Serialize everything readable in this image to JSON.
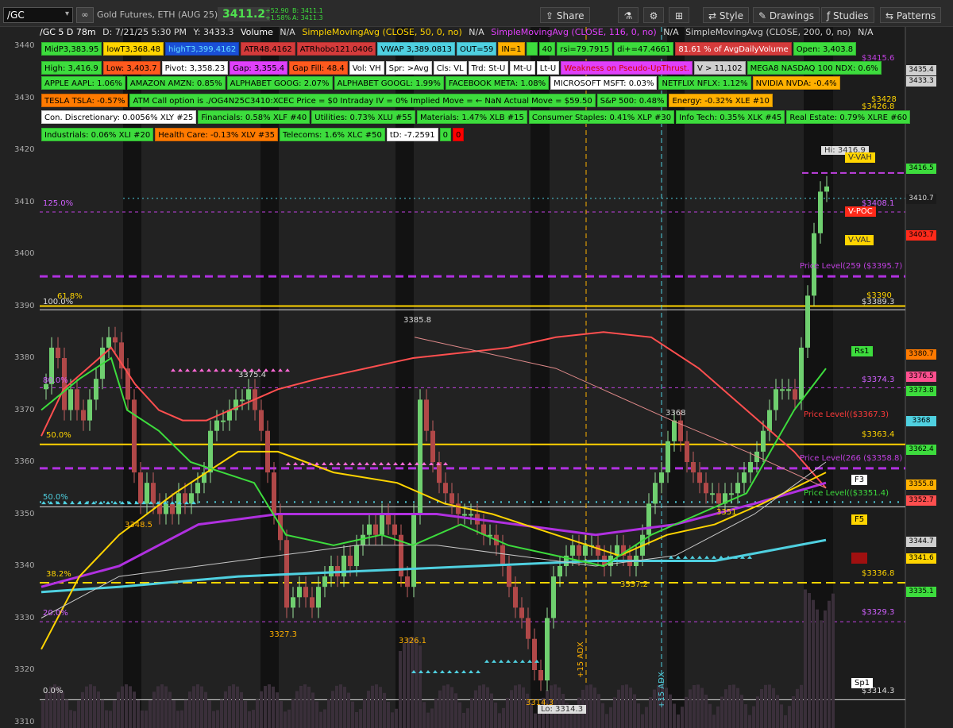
{
  "topbar": {
    "symbol": "/GC",
    "description": "Gold Futures, ETH (AUG 25)",
    "last_price": "3411.2",
    "change_abs": "+52.90",
    "change_pct": "+1.58%",
    "bid": "B: 3411.1",
    "ask": "A: 3411.3",
    "buttons": {
      "share": "Share",
      "style": "Style",
      "drawings": "Drawings",
      "studies": "Studies",
      "patterns": "Patterns"
    }
  },
  "study_bar": {
    "header": "/GC 5 D 78m",
    "datetime": "D: 7/21/25 5:30 PM",
    "cursor_y": "Y: 3433.3",
    "volume": "Volume",
    "na1": "N/A",
    "sma50": "SimpleMovingAvg (CLOSE, 50, 0, no)",
    "na2": "N/A",
    "sma116": "SimpleMovingAvg (CLOSE, 116, 0, no)",
    "na3": "N/A",
    "sma200": "SimpleMovingAvg (CLOSE, 200, 0, no)",
    "na4": "N/A"
  },
  "badges": [
    [
      {
        "text": "MidP3,383.95",
        "bg": "#3ddc3d",
        "fg": "#000"
      },
      {
        "text": "lowT3,368.48",
        "bg": "#ffd400",
        "fg": "#000"
      },
      {
        "text": "highT3,399.4162",
        "bg": "#1a4fd6",
        "fg": "#66e0ff"
      },
      {
        "text": "ATR48.4162",
        "bg": "#d43b3b",
        "fg": "#000"
      },
      {
        "text": "ATRhobo121.0406",
        "bg": "#d43b3b",
        "fg": "#000"
      },
      {
        "text": "VWAP 3,389.0813",
        "bg": "#4fd0e0",
        "fg": "#000"
      },
      {
        "text": "OUT=59",
        "bg": "#4fd0e0",
        "fg": "#000"
      },
      {
        "text": "IN=1",
        "bg": "#ffb000",
        "fg": "#000"
      },
      {
        "text": "",
        "bg": "#3ddc3d",
        "fg": "#000"
      },
      {
        "text": "40",
        "bg": "#3ddc3d",
        "fg": "#000"
      },
      {
        "text": "rsi=79.7915",
        "bg": "#3ddc3d",
        "fg": "#000"
      },
      {
        "text": "di+=47.4661",
        "bg": "#3ddc3d",
        "fg": "#000"
      },
      {
        "text": "81.61 % of AvgDailyVolume",
        "bg": "#d43b3b",
        "fg": "#fff"
      },
      {
        "text": "Open: 3,403.8",
        "bg": "#3ddc3d",
        "fg": "#000"
      }
    ],
    [
      {
        "text": "High: 3,416.9",
        "bg": "#3ddc3d",
        "fg": "#000"
      },
      {
        "text": "Low: 3,403.7",
        "bg": "#ff5a1e",
        "fg": "#000"
      },
      {
        "text": "Pivot: 3,358.23",
        "bg": "#ffffff",
        "fg": "#000"
      },
      {
        "text": "Gap: 3,355.4",
        "bg": "#e040fb",
        "fg": "#000"
      },
      {
        "text": "Gap Fill: 48.4",
        "bg": "#ff5a1e",
        "fg": "#000"
      },
      {
        "text": "Vol: VH",
        "bg": "#ffffff",
        "fg": "#000"
      },
      {
        "text": "Spr: >Avg",
        "bg": "#ffffff",
        "fg": "#000"
      },
      {
        "text": "Cls: VL",
        "bg": "#ffffff",
        "fg": "#000"
      },
      {
        "text": "Trd: St-U",
        "bg": "#ffffff",
        "fg": "#000"
      },
      {
        "text": "Mt-U",
        "bg": "#ffffff",
        "fg": "#000"
      },
      {
        "text": "Lt-U",
        "bg": "#ffffff",
        "fg": "#000"
      },
      {
        "text": "Weakness on Pseudo-UpThrust.",
        "bg": "#e040fb",
        "fg": "#d10000"
      },
      {
        "text": "V > 11,102",
        "bg": "#cfcfcf",
        "fg": "#000"
      },
      {
        "text": "MEGA8 NASDAQ 100 NDX: 0.6%",
        "bg": "#3ddc3d",
        "fg": "#000"
      }
    ],
    [
      {
        "text": "APPLE AAPL: 1.06%",
        "bg": "#3ddc3d",
        "fg": "#000"
      },
      {
        "text": "AMAZON AMZN: 0.85%",
        "bg": "#3ddc3d",
        "fg": "#000"
      },
      {
        "text": "ALPHABET GOOG: 2.07%",
        "bg": "#3ddc3d",
        "fg": "#000"
      },
      {
        "text": "ALPHABET GOOGL: 1.99%",
        "bg": "#3ddc3d",
        "fg": "#000"
      },
      {
        "text": "FACEBOOK META: 1.08%",
        "bg": "#3ddc3d",
        "fg": "#000"
      },
      {
        "text": "MICROSOFT MSFT: 0.03%",
        "bg": "#ffffff",
        "fg": "#000"
      },
      {
        "text": "NETFLIX NFLX: 1.12%",
        "bg": "#3ddc3d",
        "fg": "#000"
      },
      {
        "text": "NVIDIA NVDA: -0.4%",
        "bg": "#ffb000",
        "fg": "#000"
      }
    ],
    [
      {
        "text": "TESLA TSLA: -0.57%",
        "bg": "#ff7a00",
        "fg": "#000"
      },
      {
        "text": "ATM Call option is ./OG4N25C3410:XCEC Price = $0  Intraday IV = 0%  Implied Move = ← NaN  Actual Move = $59.50",
        "bg": "#3ddc3d",
        "fg": "#000"
      },
      {
        "text": "S&P 500: 0.48%",
        "bg": "#3ddc3d",
        "fg": "#000"
      },
      {
        "text": "Energy: -0.32% XLE #10",
        "bg": "#ffb000",
        "fg": "#000"
      }
    ],
    [
      {
        "text": "Con. Discretionary: 0.0056% XLY #25",
        "bg": "#ffffff",
        "fg": "#000"
      },
      {
        "text": "Financials: 0.58% XLF #40",
        "bg": "#3ddc3d",
        "fg": "#000"
      },
      {
        "text": "Utilities: 0.73% XLU #55",
        "bg": "#3ddc3d",
        "fg": "#000"
      },
      {
        "text": "Materials: 1.47% XLB #15",
        "bg": "#3ddc3d",
        "fg": "#000"
      },
      {
        "text": "Consumer Staples: 0.41% XLP #30",
        "bg": "#3ddc3d",
        "fg": "#000"
      },
      {
        "text": "Info Tech: 0.35% XLK #45",
        "bg": "#3ddc3d",
        "fg": "#000"
      },
      {
        "text": "Real Estate: 0.79% XLRE #60",
        "bg": "#3ddc3d",
        "fg": "#000"
      }
    ],
    [
      {
        "text": "Industrials: 0.06% XLI #20",
        "bg": "#3ddc3d",
        "fg": "#000"
      },
      {
        "text": "Health Care: -0.13% XLV #35",
        "bg": "#ff7a00",
        "fg": "#000"
      },
      {
        "text": "Telecoms: 1.6% XLC #50",
        "bg": "#3ddc3d",
        "fg": "#000"
      },
      {
        "text": "tD: -7.2591",
        "bg": "#ffffff",
        "fg": "#000"
      },
      {
        "text": "0",
        "bg": "#3ddc3d",
        "fg": "#000"
      },
      {
        "text": "0",
        "bg": "#ff0000",
        "fg": "#000"
      }
    ]
  ],
  "y_axis_ticks": [
    "3440",
    "3430",
    "3420",
    "3410",
    "3400",
    "3390",
    "3380",
    "3370",
    "3360",
    "3350",
    "3340",
    "3330",
    "3320",
    "3310"
  ],
  "right_labels": [
    {
      "price": 3435.4,
      "text": "3435.4",
      "bg": "#cfcfcf"
    },
    {
      "price": 3433.3,
      "text": "3433.3",
      "bg": "#cfcfcf"
    },
    {
      "price": 3416.5,
      "text": "3416.5",
      "bg": "#3ddc3d"
    },
    {
      "price": 3410.7,
      "text": "3410.7",
      "bg": "#1b1b1b",
      "fg": "#ddd"
    },
    {
      "price": 3403.7,
      "text": "3403.7",
      "bg": "#ff2a1a"
    },
    {
      "price": 3380.7,
      "text": "3380.7",
      "bg": "#ff7a00"
    },
    {
      "price": 3376.5,
      "text": "3376.5",
      "bg": "#ff4f8f"
    },
    {
      "price": 3373.8,
      "text": "3373.8",
      "bg": "#3ddc3d"
    },
    {
      "price": 3368,
      "text": "3368",
      "bg": "#4fd0e0"
    },
    {
      "price": 3362.4,
      "text": "3362.4",
      "bg": "#3ddc3d"
    },
    {
      "price": 3355.8,
      "text": "3355.8",
      "bg": "#ffb000"
    },
    {
      "price": 3352.7,
      "text": "3352.7",
      "bg": "#ff4f4f"
    },
    {
      "price": 3344.7,
      "text": "3344.7",
      "bg": "#cfcfcf"
    },
    {
      "price": 3341.6,
      "text": "3341.6",
      "bg": "#ffd400"
    },
    {
      "price": 3335.1,
      "text": "3335.1",
      "bg": "#3ddc3d"
    }
  ],
  "chart_text": {
    "hi_label": "Hi: 3416.9",
    "lo_label": "Lo: 3314.3",
    "v_vah": "V-VAH",
    "v_poc": "V-POC",
    "v_val": "V-VAL",
    "rs1": "Rs1",
    "f3": "F3",
    "f5": "F5",
    "sp1": "Sp1",
    "price_level_259": "Price Level(259 ($3395.7)",
    "price_level_m": "Price Level(($3367.3)",
    "price_level_266": "Price Level(266 ($3358.8)",
    "price_level_r": "Price Level(($3351.4)",
    "fib_125": "125.0%",
    "fib_100": "100.0%",
    "fib_618": "61.8%",
    "fib_50a": "50.0%",
    "fib_50b": "50.0%",
    "fib_382": "38.2%",
    "fib_0": "0.0%",
    "fib_20": "20.0%",
    "fib_80": "80.0%",
    "fib_50c": "50.0%",
    "lv_3428": "$3428",
    "lv_34266": "$3426.8",
    "lv_3415": "$3415.6",
    "lv_3408": "$3408.1",
    "lv_3390": "$3390",
    "lv_33893": "$3389.3",
    "lv_33743": "$3374.3",
    "lv_33634": "$3363.4",
    "lv_33368": "$3336.8",
    "lv_33293": "$3329.3",
    "lv_33143": "$3314.3",
    "ann_3385": "3385.8",
    "ann_3375": "3375.4",
    "ann_3368": "3368",
    "ann_3348": "3348.5",
    "ann_3351": "3351",
    "ann_3337": "3337.2",
    "ann_3327": "3327.3",
    "ann_3326": "3326.1",
    "ann_3314": "3314.3",
    "adx1": "+15 ADX",
    "adx2": "+15 ADX"
  }
}
